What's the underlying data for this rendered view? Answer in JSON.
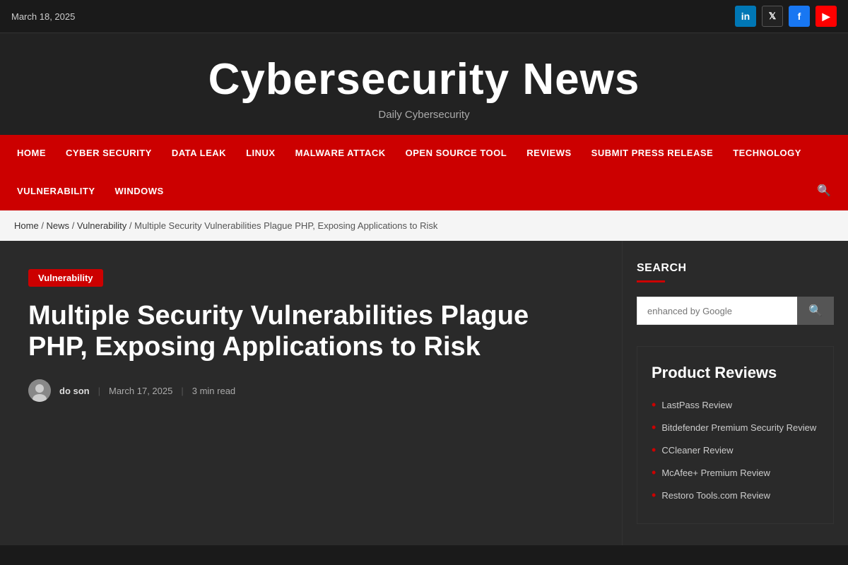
{
  "topbar": {
    "date": "March 18, 2025",
    "social": [
      {
        "name": "linkedin",
        "label": "in"
      },
      {
        "name": "twitter",
        "label": "𝕏"
      },
      {
        "name": "facebook",
        "label": "f"
      },
      {
        "name": "youtube",
        "label": "▶"
      }
    ]
  },
  "header": {
    "site_title": "Cybersecurity News",
    "site_subtitle": "Daily Cybersecurity"
  },
  "nav": {
    "items": [
      {
        "id": "home",
        "label": "HOME"
      },
      {
        "id": "cyber-security",
        "label": "CYBER SECURITY"
      },
      {
        "id": "data-leak",
        "label": "DATA LEAK"
      },
      {
        "id": "linux",
        "label": "LINUX"
      },
      {
        "id": "malware-attack",
        "label": "MALWARE ATTACK"
      },
      {
        "id": "open-source-tool",
        "label": "OPEN SOURCE TOOL"
      },
      {
        "id": "reviews",
        "label": "REVIEWS"
      },
      {
        "id": "submit-press-release",
        "label": "SUBMIT PRESS RELEASE"
      },
      {
        "id": "technology",
        "label": "TECHNOLOGY"
      },
      {
        "id": "vulnerability",
        "label": "VULNERABILITY"
      },
      {
        "id": "windows",
        "label": "WINDOWS"
      }
    ]
  },
  "breadcrumb": {
    "items": [
      {
        "label": "Home",
        "href": "#"
      },
      {
        "label": "News",
        "href": "#"
      },
      {
        "label": "Vulnerability",
        "href": "#"
      },
      {
        "label": "Multiple Security Vulnerabilities Plague PHP, Exposing Applications to Risk",
        "href": "#"
      }
    ],
    "separator": "/"
  },
  "article": {
    "category": "Vulnerability",
    "title": "Multiple Security Vulnerabilities Plague PHP, Exposing Applications to Risk",
    "author": "do son",
    "date": "March 17, 2025",
    "read_time": "3 min read"
  },
  "sidebar": {
    "search": {
      "title": "SEARCH",
      "placeholder": "enhanced by Google",
      "button_label": "🔍"
    },
    "product_reviews": {
      "title": "Product Reviews",
      "items": [
        {
          "label": "LastPass Review"
        },
        {
          "label": "Bitdefender Premium Security Review"
        },
        {
          "label": "CCleaner Review"
        },
        {
          "label": "McAfee+ Premium Review"
        },
        {
          "label": "Restoro Tools.com Review"
        }
      ]
    }
  }
}
